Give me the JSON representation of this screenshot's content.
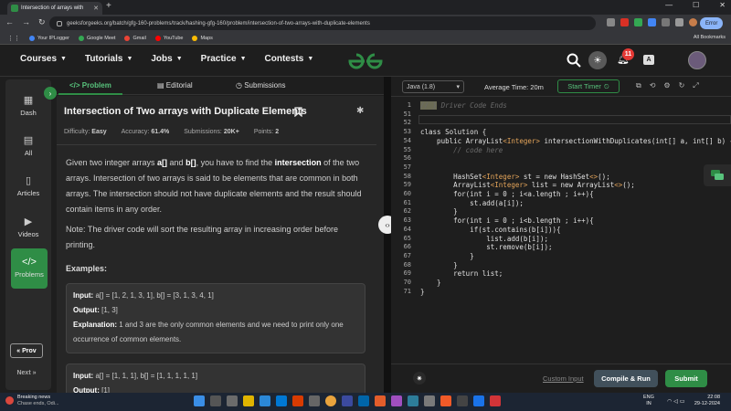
{
  "browser": {
    "tab_title": "Intersection of arrays with",
    "url": "geeksforgeeks.org/batch/gfg-160-problems/track/hashing-gfg-160/problem/intersection-of-two-arrays-with-duplicate-elements",
    "error_label": "Error",
    "bookmarks": [
      "Your IPLogger",
      "Google Meet",
      "Gmail",
      "YouTube",
      "Maps"
    ],
    "all_bookmarks": "All Bookmarks"
  },
  "header": {
    "nav": [
      "Courses",
      "Tutorials",
      "Jobs",
      "Practice",
      "Contests"
    ],
    "notification_count": "11",
    "translate_label": "A"
  },
  "sidebar": {
    "items": [
      {
        "label": "Dash"
      },
      {
        "label": "All"
      },
      {
        "label": "Articles"
      },
      {
        "label": "Videos"
      },
      {
        "label": "Problems"
      }
    ],
    "prev_label": "« Prov",
    "next_label": "Next »"
  },
  "problem": {
    "tabs": [
      "Problem",
      "Editorial",
      "Submissions"
    ],
    "title": "Intersection of Two arrays with Duplicate Elements",
    "meta": {
      "difficulty_label": "Difficulty:",
      "difficulty": "Easy",
      "accuracy_label": "Accuracy:",
      "accuracy": "61.4%",
      "submissions_label": "Submissions:",
      "submissions": "20K+",
      "points_label": "Points:",
      "points": "2"
    },
    "desc_parts": [
      "Given two integer arrays ",
      "a[]",
      " and ",
      "b[]",
      ", you have to find the ",
      "intersection",
      " of the two arrays. Intersection of two arrays is said to be elements that are common in both arrays. The intersection should not have duplicate elements and the result should contain items in any order."
    ],
    "note": "Note: The driver code will sort the resulting array in increasing order before printing.",
    "examples_heading": "Examples:",
    "example1": {
      "input_label": "Input:",
      "input": "a[] = [1, 2, 1, 3, 1], b[] = [3, 1, 3, 4, 1]",
      "output_label": "Output:",
      "output": "[1, 3]",
      "explanation_label": "Explanation:",
      "explanation": "1 and 3 are the only common elements and we need to print only one occurrence of common elements."
    },
    "example2": {
      "input_label": "Input:",
      "input": "a[] = [1, 1, 1], b[] = [1, 1, 1, 1, 1]",
      "output_label": "Output:",
      "output": "[1]"
    }
  },
  "editor": {
    "language": "Java (1.8)",
    "avg_time": "Average Time: 20m",
    "start_timer": "Start Timer",
    "line_numbers": [
      "1",
      "51",
      "52",
      "53",
      "54",
      "55",
      "56",
      "57",
      "58",
      "59",
      "60",
      "61",
      "62",
      "63",
      "64",
      "65",
      "66",
      "67",
      "68",
      "69",
      "70",
      "71"
    ],
    "code_lines": [
      "// } Driver Code Ends",
      "",
      "",
      "class Solution {",
      "    public ArrayList<Integer> intersectionWithDuplicates(int[] a, int[] b) {",
      "        // code here",
      "",
      "",
      "        HashSet<Integer> st = new HashSet<>();",
      "        ArrayList<Integer> list = new ArrayList<>();",
      "        for(int i = 0 ; i<a.length ; i++){",
      "            st.add(a[i]);",
      "        }",
      "        for(int i = 0 ; i<b.length ; i++){",
      "            if(st.contains(b[i])){",
      "                list.add(b[i]);",
      "                st.remove(b[i]);",
      "            }",
      "        }",
      "        return list;",
      "    }",
      "}"
    ],
    "custom_input": "Custom Input",
    "compile_run": "Compile & Run",
    "submit": "Submit"
  },
  "taskbar": {
    "news_title": "Breaking news",
    "news_sub": "Chase ends, Odi...",
    "lang": "ENG",
    "region": "IN",
    "time": "22:08",
    "date": "29-12-2024"
  },
  "colors": {
    "accent": "#2f8d46",
    "badge": "#e53935",
    "bg": "#1e1e1e"
  }
}
